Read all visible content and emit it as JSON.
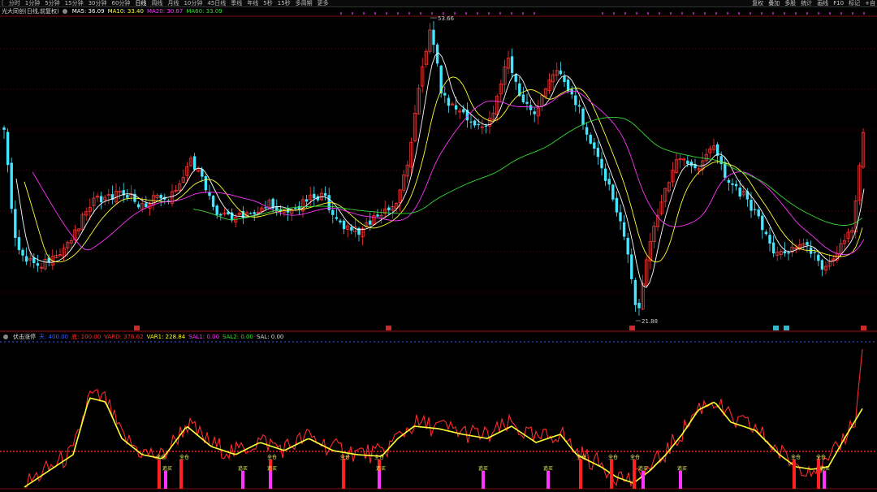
{
  "toolbar": {
    "back": "[",
    "periods": [
      {
        "label": "分时"
      },
      {
        "label": "1分钟"
      },
      {
        "label": "5分钟"
      },
      {
        "label": "15分钟"
      },
      {
        "label": "30分钟"
      },
      {
        "label": "60分钟"
      },
      {
        "label": "日线",
        "active": true
      },
      {
        "label": "周线"
      },
      {
        "label": "月线"
      },
      {
        "label": "10分钟"
      },
      {
        "label": "45日线"
      },
      {
        "label": "季线"
      },
      {
        "label": "年线"
      },
      {
        "label": "5秒"
      },
      {
        "label": "15秒"
      },
      {
        "label": "多周期"
      },
      {
        "label": "更多"
      }
    ],
    "right_buttons": [
      {
        "label": "复权"
      },
      {
        "label": "叠加"
      },
      {
        "label": "多股"
      },
      {
        "label": "统计"
      },
      {
        "label": "画线"
      },
      {
        "label": "F10"
      },
      {
        "label": "标记"
      },
      {
        "label": "+自"
      }
    ]
  },
  "price_header": {
    "stock": "光大同创(日线,前复权)",
    "ma5": "MA5: 36.09",
    "ma10": "MA10: 33.40",
    "ma20": "MA20: 30.87",
    "ma60": "MA60: 33.09"
  },
  "indicator_header": {
    "name": "伏击涨停",
    "items": [
      {
        "text": "天: 400.00",
        "color": "#3a5cff"
      },
      {
        "text": "底: 100.00",
        "color": "#ff2a2a"
      },
      {
        "text": "VARD: 376.62",
        "color": "#ff2a2a"
      },
      {
        "text": "VAR1: 228.84",
        "color": "#ffff33"
      },
      {
        "text": "SAL1: 0.00",
        "color": "#ff33ff"
      },
      {
        "text": "SAL2: 0.00",
        "color": "#33dd33"
      },
      {
        "text": "SAL: 0.00",
        "color": "#dddddd"
      }
    ]
  },
  "annotations": {
    "high_label": "53.66",
    "low_label": "21.88",
    "lower_signal_labels": [
      "全仓",
      "追买"
    ]
  },
  "colors": {
    "up": "#ff3333",
    "down": "#44e5ff",
    "ma5": "#ffffff",
    "ma10": "#ffff33",
    "ma20": "#ff33ff",
    "ma60": "#33dd33",
    "grid": "#8b1a1a",
    "buy_bar": "#ff2020",
    "add_bar": "#ff33ff"
  },
  "chart_data": {
    "type": "candlestick",
    "y_labels_printed": {
      "high": 53.66,
      "low": 21.88
    },
    "full_position_markers": 12,
    "chase_buy_markers": 9
  }
}
